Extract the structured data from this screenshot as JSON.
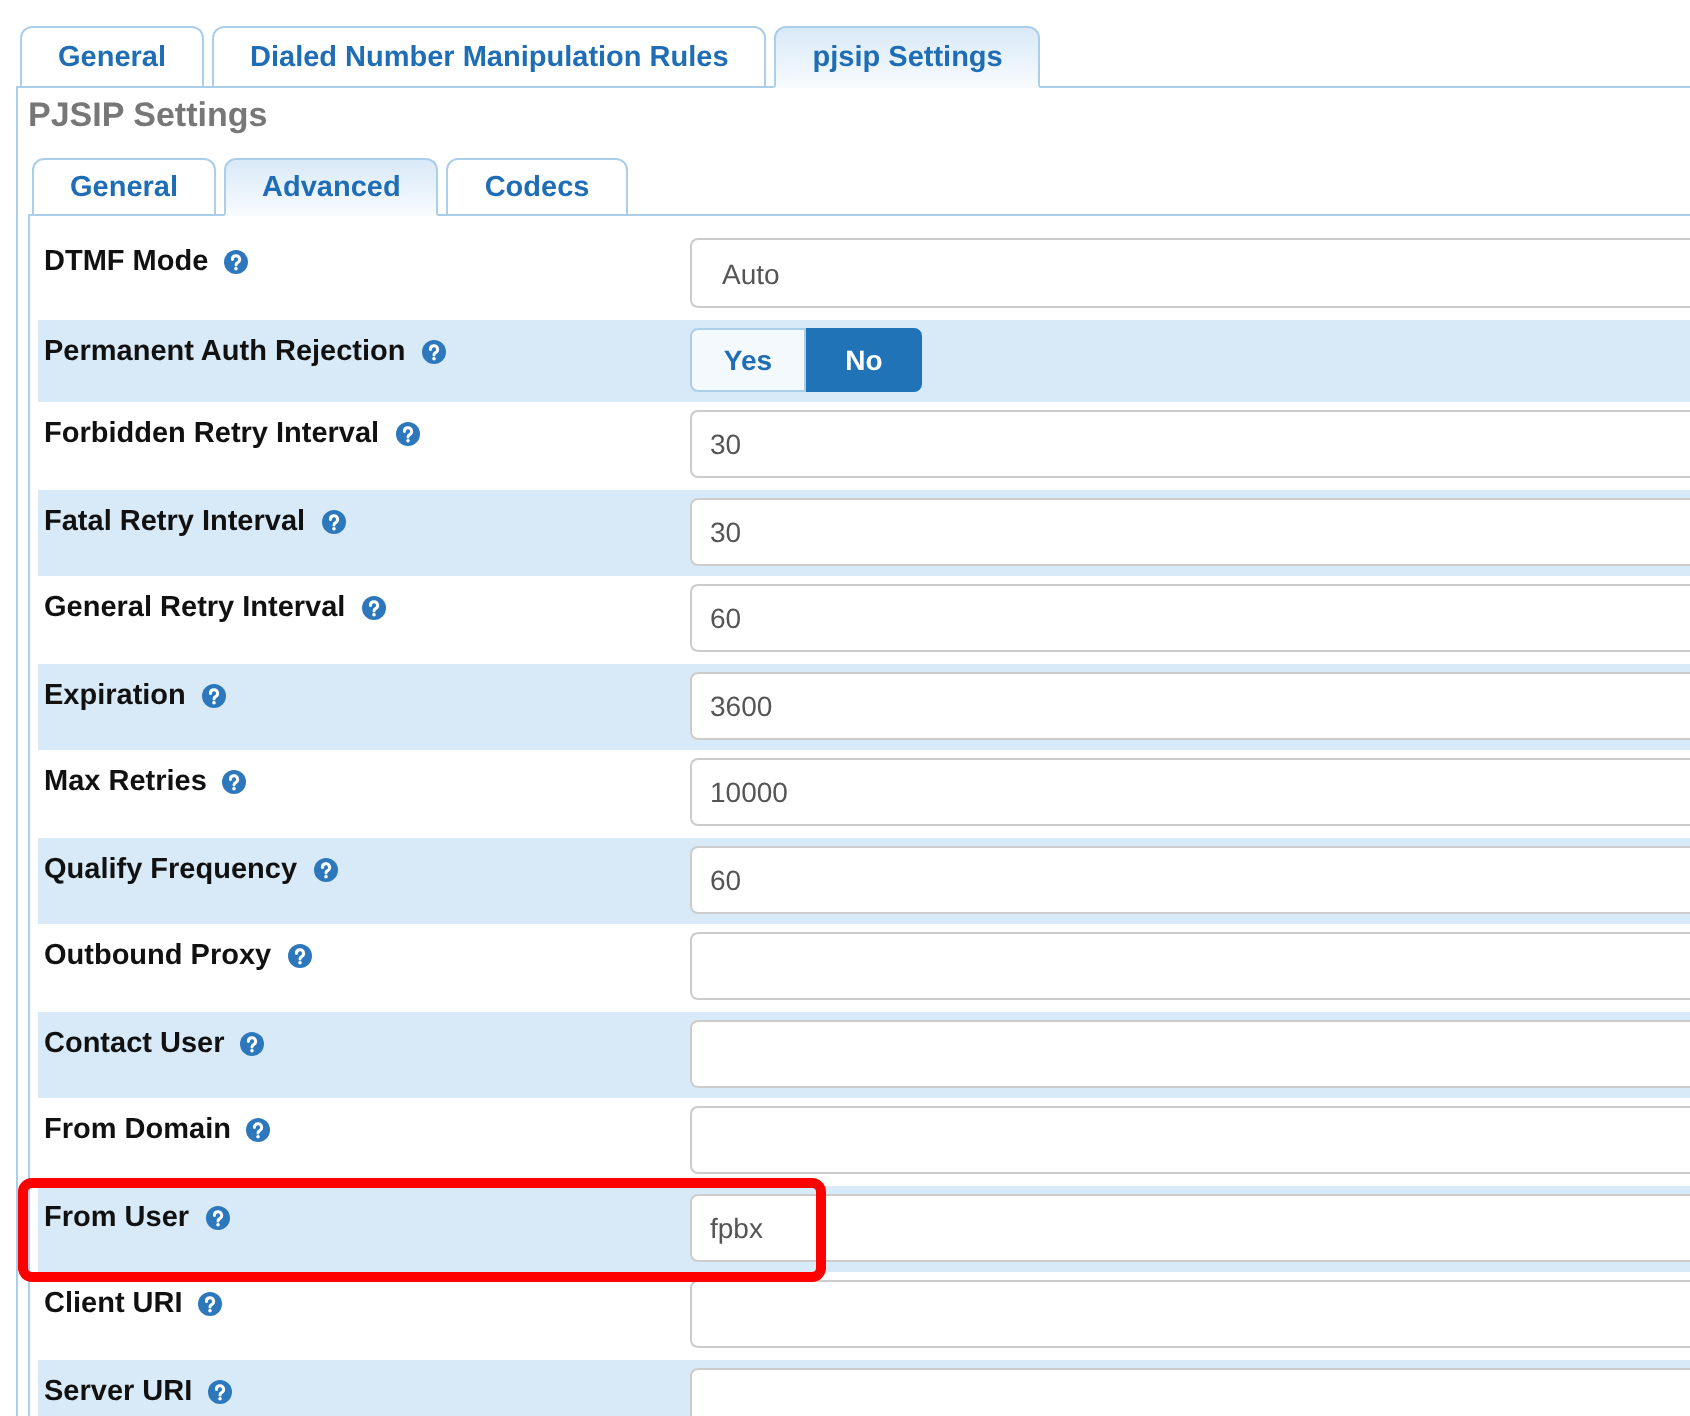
{
  "tabs": [
    {
      "label": "General",
      "selected": false
    },
    {
      "label": "Dialed Number Manipulation Rules",
      "selected": false
    },
    {
      "label": "pjsip Settings",
      "selected": true
    }
  ],
  "section": {
    "title": "PJSIP Settings",
    "tabs": [
      {
        "label": "General",
        "selected": false
      },
      {
        "label": "Advanced",
        "selected": true
      },
      {
        "label": "Codecs",
        "selected": false
      }
    ],
    "fields": [
      {
        "kind": "select",
        "label": "DTMF Mode",
        "value": "Auto",
        "annotated": false
      },
      {
        "kind": "toggle",
        "label": "Permanent Auth Rejection",
        "options": [
          {
            "label": "Yes",
            "selected": false
          },
          {
            "label": "No",
            "selected": true
          }
        ],
        "annotated": false
      },
      {
        "kind": "text",
        "label": "Forbidden Retry Interval",
        "value": "30",
        "annotated": false
      },
      {
        "kind": "text",
        "label": "Fatal Retry Interval",
        "value": "30",
        "annotated": false
      },
      {
        "kind": "text",
        "label": "General Retry Interval",
        "value": "60",
        "annotated": false
      },
      {
        "kind": "text",
        "label": "Expiration",
        "value": "3600",
        "annotated": false
      },
      {
        "kind": "text",
        "label": "Max Retries",
        "value": "10000",
        "annotated": false
      },
      {
        "kind": "text",
        "label": "Qualify Frequency",
        "value": "60",
        "annotated": false
      },
      {
        "kind": "text",
        "label": "Outbound Proxy",
        "annotated": false
      },
      {
        "kind": "text",
        "label": "Contact User",
        "annotated": false
      },
      {
        "kind": "text",
        "label": "From Domain",
        "annotated": false
      },
      {
        "kind": "text",
        "label": "From User",
        "value": "fpbx",
        "annotated": true
      },
      {
        "kind": "text",
        "label": "Client URI",
        "annotated": false
      },
      {
        "kind": "text",
        "label": "Server URI",
        "annotated": false
      }
    ]
  }
}
